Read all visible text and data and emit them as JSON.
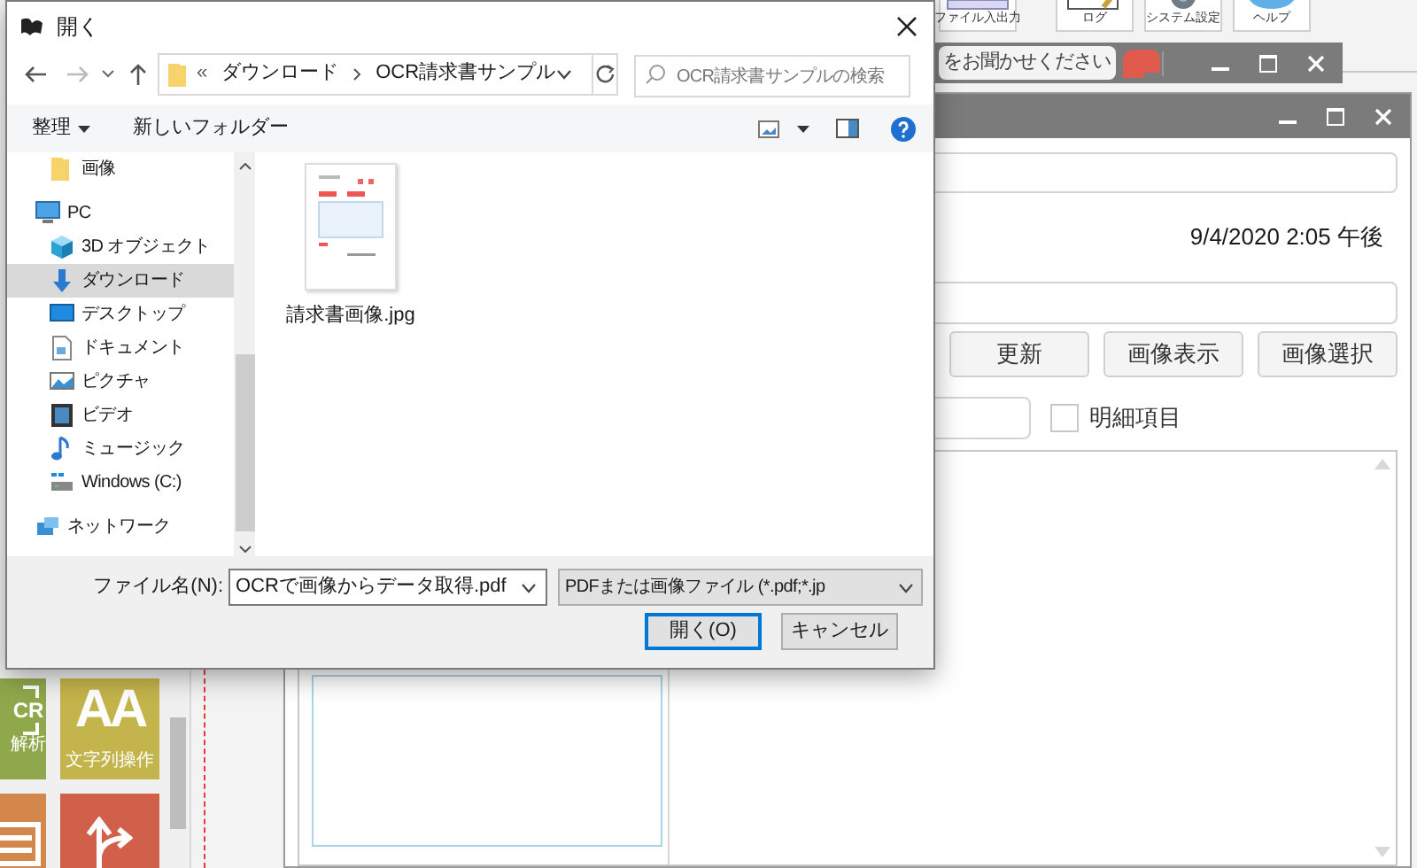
{
  "app_toolbar": {
    "buttons": [
      {
        "label": "ファイル入出力",
        "kind": "file"
      },
      {
        "label": "ログ",
        "kind": "log"
      },
      {
        "label": "システム設定",
        "kind": "settings"
      },
      {
        "label": "ヘルプ",
        "kind": "help"
      }
    ]
  },
  "feedback_bar": {
    "text": "をお聞かせください"
  },
  "palette": {
    "tiles": [
      {
        "kind": "ocr",
        "glyph": "CR",
        "label": "解析",
        "color": "#8fa84b"
      },
      {
        "kind": "text",
        "glyph": "AA",
        "label": "文字列操作",
        "color": "#c4b44c"
      },
      {
        "kind": "list",
        "color": "#d4874a"
      },
      {
        "kind": "branch",
        "color": "#d0604a"
      }
    ]
  },
  "sub_window": {
    "datetime": "9/4/2020 2:05 午後",
    "buttons": [
      "更新",
      "画像表示",
      "画像選択"
    ],
    "checkbox": {
      "label": "明細項目",
      "checked": false
    }
  },
  "dialog": {
    "title": "開く",
    "breadcrumb": [
      {
        "label": "«",
        "kind": "overflow"
      },
      {
        "label": "ダウンロード",
        "kind": "folder"
      },
      {
        "label": "OCR請求書サンプル",
        "kind": "folder"
      }
    ],
    "search": {
      "placeholder": "OCR請求書サンプルの検索"
    },
    "toolbar": {
      "organize": "整理",
      "new_folder": "新しいフォルダー"
    },
    "nav_tree": [
      {
        "children": [
          {
            "label": "画像",
            "kind": "folder",
            "selected": false
          }
        ]
      },
      {
        "label": "PC",
        "kind": "pc",
        "selected": false,
        "children": [
          {
            "label": "3D オブジェクト",
            "kind": "cube",
            "selected": false
          },
          {
            "label": "ダウンロード",
            "kind": "download",
            "selected": true
          },
          {
            "label": "デスクトップ",
            "kind": "desktop",
            "selected": false
          },
          {
            "label": "ドキュメント",
            "kind": "document",
            "selected": false
          },
          {
            "label": "ピクチャ",
            "kind": "picture",
            "selected": false
          },
          {
            "label": "ビデオ",
            "kind": "video",
            "selected": false
          },
          {
            "label": "ミュージック",
            "kind": "music",
            "selected": false
          },
          {
            "label": "Windows (C:)",
            "kind": "drive",
            "selected": false
          }
        ]
      },
      {
        "label": "ネットワーク",
        "kind": "network",
        "selected": false
      }
    ],
    "files": [
      {
        "name": "請求書画像.jpg",
        "selected": false
      }
    ],
    "file_name": {
      "label": "ファイル名(N):",
      "value": "OCRで画像からデータ取得.pdf"
    },
    "file_type": {
      "value": "PDFまたは画像ファイル (*.pdf;*.jp"
    },
    "buttons": [
      {
        "label": "開く(O)",
        "default": true
      },
      {
        "label": "キャンセル",
        "default": false
      }
    ]
  }
}
